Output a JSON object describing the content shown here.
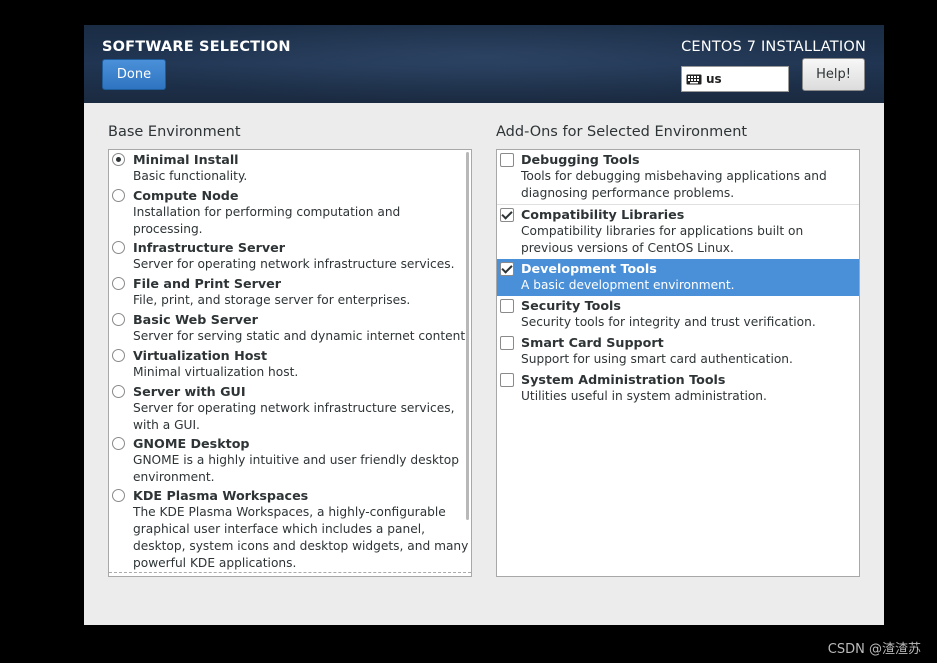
{
  "header": {
    "title": "SOFTWARE SELECTION",
    "done_label": "Done",
    "install_title": "CENTOS 7 INSTALLATION",
    "keyboard_layout": "us",
    "help_label": "Help!"
  },
  "base_environment": {
    "title": "Base Environment",
    "items": [
      {
        "name": "Minimal Install",
        "desc": "Basic functionality.",
        "selected": true
      },
      {
        "name": "Compute Node",
        "desc": "Installation for performing computation and processing.",
        "selected": false
      },
      {
        "name": "Infrastructure Server",
        "desc": "Server for operating network infrastructure services.",
        "selected": false
      },
      {
        "name": "File and Print Server",
        "desc": "File, print, and storage server for enterprises.",
        "selected": false
      },
      {
        "name": "Basic Web Server",
        "desc": "Server for serving static and dynamic internet content.",
        "selected": false
      },
      {
        "name": "Virtualization Host",
        "desc": "Minimal virtualization host.",
        "selected": false
      },
      {
        "name": "Server with GUI",
        "desc": "Server for operating network infrastructure services, with a GUI.",
        "selected": false
      },
      {
        "name": "GNOME Desktop",
        "desc": "GNOME is a highly intuitive and user friendly desktop environment.",
        "selected": false
      },
      {
        "name": "KDE Plasma Workspaces",
        "desc": "The KDE Plasma Workspaces, a highly-configurable graphical user interface which includes a panel, desktop, system icons and desktop widgets, and many powerful KDE applications.",
        "selected": false
      }
    ]
  },
  "addons": {
    "title": "Add-Ons for Selected Environment",
    "items": [
      {
        "name": "Debugging Tools",
        "desc": "Tools for debugging misbehaving applications and diagnosing performance problems.",
        "checked": false,
        "highlighted": false
      },
      {
        "name": "Compatibility Libraries",
        "desc": "Compatibility libraries for applications built on previous versions of CentOS Linux.",
        "checked": true,
        "highlighted": false
      },
      {
        "name": "Development Tools",
        "desc": "A basic development environment.",
        "checked": true,
        "highlighted": true
      },
      {
        "name": "Security Tools",
        "desc": "Security tools for integrity and trust verification.",
        "checked": false,
        "highlighted": false
      },
      {
        "name": "Smart Card Support",
        "desc": "Support for using smart card authentication.",
        "checked": false,
        "highlighted": false
      },
      {
        "name": "System Administration Tools",
        "desc": "Utilities useful in system administration.",
        "checked": false,
        "highlighted": false
      }
    ]
  },
  "watermark": "CSDN @渣渣苏",
  "colors": {
    "accent": "#4a90d9",
    "header_bg": "#1f3350",
    "window_bg": "#ececec"
  }
}
